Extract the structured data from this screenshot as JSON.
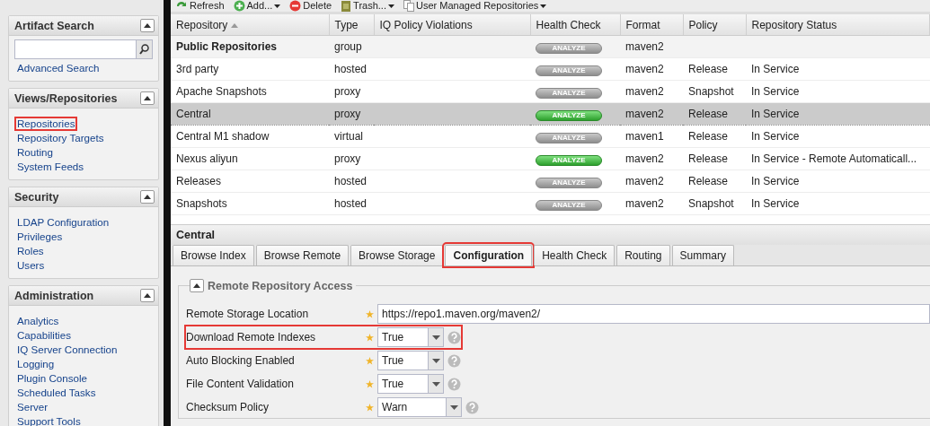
{
  "sidebar": {
    "panels": [
      {
        "title": "Artifact Search",
        "kind": "search",
        "items": [
          {
            "label": "Advanced Search",
            "highlighted": false
          }
        ]
      },
      {
        "title": "Views/Repositories",
        "kind": "links",
        "items": [
          {
            "label": "Repositories",
            "highlighted": true
          },
          {
            "label": "Repository Targets",
            "highlighted": false
          },
          {
            "label": "Routing",
            "highlighted": false
          },
          {
            "label": "System Feeds",
            "highlighted": false
          }
        ]
      },
      {
        "title": "Security",
        "kind": "links",
        "items": [
          {
            "label": "LDAP Configuration",
            "highlighted": false
          },
          {
            "label": "Privileges",
            "highlighted": false
          },
          {
            "label": "Roles",
            "highlighted": false
          },
          {
            "label": "Users",
            "highlighted": false
          }
        ]
      },
      {
        "title": "Administration",
        "kind": "links",
        "items": [
          {
            "label": "Analytics",
            "highlighted": false
          },
          {
            "label": "Capabilities",
            "highlighted": false
          },
          {
            "label": "IQ Server Connection",
            "highlighted": false
          },
          {
            "label": "Logging",
            "highlighted": false
          },
          {
            "label": "Plugin Console",
            "highlighted": false
          },
          {
            "label": "Scheduled Tasks",
            "highlighted": false
          },
          {
            "label": "Server",
            "highlighted": false
          },
          {
            "label": "Support Tools",
            "highlighted": false
          }
        ]
      }
    ]
  },
  "toolbar": [
    {
      "label": "Refresh",
      "kind": "refresh",
      "menu": false
    },
    {
      "label": "Add...",
      "kind": "add",
      "menu": true
    },
    {
      "label": "Delete",
      "kind": "delete",
      "menu": false
    },
    {
      "label": "Trash...",
      "kind": "trash",
      "menu": true
    },
    {
      "label": "User Managed Repositories",
      "kind": "pages",
      "menu": true
    }
  ],
  "table": {
    "columns": [
      "Repository",
      "Type",
      "IQ Policy Violations",
      "Health Check",
      "Format",
      "Policy",
      "Repository Status"
    ],
    "rows": [
      {
        "repository": "Public Repositories",
        "type": "group",
        "health": "ANALYZE",
        "health_on": false,
        "format": "maven2",
        "policy": "",
        "status": "",
        "selected": false,
        "group": true
      },
      {
        "repository": "3rd party",
        "type": "hosted",
        "health": "ANALYZE",
        "health_on": false,
        "format": "maven2",
        "policy": "Release",
        "status": "In Service",
        "selected": false,
        "group": false
      },
      {
        "repository": "Apache Snapshots",
        "type": "proxy",
        "health": "ANALYZE",
        "health_on": false,
        "format": "maven2",
        "policy": "Snapshot",
        "status": "In Service",
        "selected": false,
        "group": false
      },
      {
        "repository": "Central",
        "type": "proxy",
        "health": "ANALYZE",
        "health_on": true,
        "format": "maven2",
        "policy": "Release",
        "status": "In Service",
        "selected": true,
        "group": false
      },
      {
        "repository": "Central M1 shadow",
        "type": "virtual",
        "health": "ANALYZE",
        "health_on": false,
        "format": "maven1",
        "policy": "Release",
        "status": "In Service",
        "selected": false,
        "group": false
      },
      {
        "repository": "Nexus aliyun",
        "type": "proxy",
        "health": "ANALYZE",
        "health_on": true,
        "format": "maven2",
        "policy": "Release",
        "status": "In Service - Remote Automaticall...",
        "selected": false,
        "group": false
      },
      {
        "repository": "Releases",
        "type": "hosted",
        "health": "ANALYZE",
        "health_on": false,
        "format": "maven2",
        "policy": "Release",
        "status": "In Service",
        "selected": false,
        "group": false
      },
      {
        "repository": "Snapshots",
        "type": "hosted",
        "health": "ANALYZE",
        "health_on": false,
        "format": "maven2",
        "policy": "Snapshot",
        "status": "In Service",
        "selected": false,
        "group": false
      }
    ]
  },
  "detail": {
    "title": "Central",
    "tabs": [
      {
        "label": "Browse Index",
        "selected": false,
        "highlighted": false
      },
      {
        "label": "Browse Remote",
        "selected": false,
        "highlighted": false
      },
      {
        "label": "Browse Storage",
        "selected": false,
        "highlighted": false
      },
      {
        "label": "Configuration",
        "selected": true,
        "highlighted": true
      },
      {
        "label": "Health Check",
        "selected": false,
        "highlighted": false
      },
      {
        "label": "Routing",
        "selected": false,
        "highlighted": false
      },
      {
        "label": "Summary",
        "selected": false,
        "highlighted": false
      }
    ],
    "fieldset": {
      "title": "Remote Repository Access",
      "fields": [
        {
          "label": "Remote Storage Location",
          "kind": "text",
          "value": "https://repo1.maven.org/maven2/",
          "highlighted": false
        },
        {
          "label": "Download Remote Indexes",
          "kind": "select",
          "value": "True",
          "highlighted": true
        },
        {
          "label": "Auto Blocking Enabled",
          "kind": "select",
          "value": "True",
          "highlighted": false
        },
        {
          "label": "File Content Validation",
          "kind": "select",
          "value": "True",
          "highlighted": false
        },
        {
          "label": "Checksum Policy",
          "kind": "select-wide",
          "value": "Warn",
          "highlighted": false
        }
      ]
    }
  }
}
